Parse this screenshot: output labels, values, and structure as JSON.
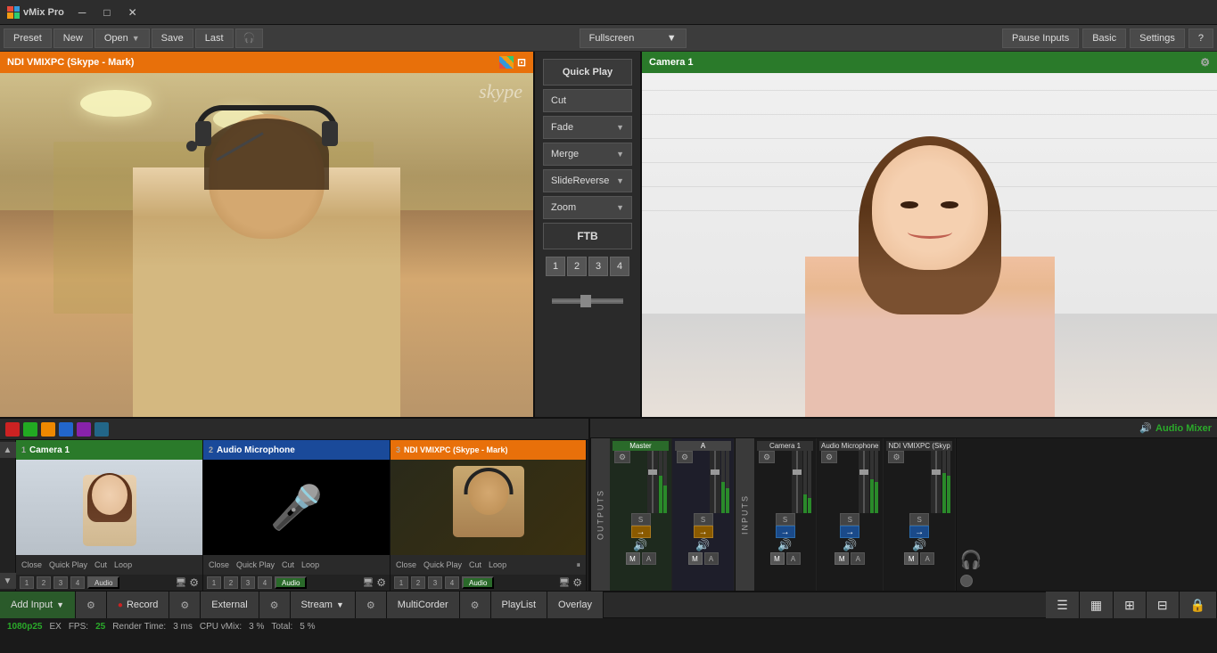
{
  "titlebar": {
    "title": "vMix Pro",
    "min_label": "─",
    "max_label": "□",
    "close_label": "✕"
  },
  "menubar": {
    "preset_label": "Preset",
    "new_label": "New",
    "open_label": "Open",
    "save_label": "Save",
    "last_label": "Last",
    "fullscreen_label": "Fullscreen",
    "pause_inputs_label": "Pause Inputs",
    "basic_label": "Basic",
    "settings_label": "Settings",
    "help_label": "?"
  },
  "preview": {
    "header": "NDI VMIXPC (Skype - Mark)",
    "watermark": "skype"
  },
  "output": {
    "header": "Camera 1"
  },
  "transitions": {
    "quick_play": "Quick Play",
    "cut": "Cut",
    "fade": "Fade",
    "merge": "Merge",
    "slide_reverse": "SlideReverse",
    "zoom": "Zoom",
    "ftb": "FTB",
    "numbers": [
      "1",
      "2",
      "3",
      "4"
    ]
  },
  "inputs": {
    "colors": [
      "red",
      "green",
      "orange",
      "blue",
      "purple",
      "teal"
    ],
    "cards": [
      {
        "num": "1",
        "label": "Camera 1",
        "type": "camera",
        "header_class": "green",
        "controls": [
          "Close",
          "Quick Play",
          "Cut",
          "Loop"
        ],
        "num_buttons": [
          "1",
          "2",
          "3",
          "4"
        ],
        "audio_active": false
      },
      {
        "num": "2",
        "label": "Audio Microphone",
        "type": "audio",
        "header_class": "blue",
        "controls": [
          "Close",
          "Quick Play",
          "Cut",
          "Loop"
        ],
        "num_buttons": [
          "1",
          "2",
          "3",
          "4"
        ],
        "audio_active": true
      },
      {
        "num": "3",
        "label": "NDI VMIXPC (Skype - Mark)",
        "type": "skype",
        "header_class": "orange",
        "controls": [
          "Close",
          "Quick Play",
          "Cut",
          "Loop"
        ],
        "num_buttons": [
          "1",
          "2",
          "3",
          "4"
        ],
        "audio_active": true
      }
    ]
  },
  "audio_mixer": {
    "title": "Audio Mixer",
    "channels": [
      {
        "label": "Master",
        "type": "master"
      },
      {
        "label": "A",
        "type": "a"
      },
      {
        "label": "Camera 1",
        "type": "input"
      },
      {
        "label": "Audio Microphone",
        "type": "input"
      },
      {
        "label": "NDI VMIXPC (Skyp",
        "type": "input"
      }
    ]
  },
  "bottom_toolbar": {
    "add_input": "Add Input",
    "record": "Record",
    "external": "External",
    "stream": "Stream",
    "multicorder": "MultiCorder",
    "playlist": "PlayList",
    "overlay": "Overlay"
  },
  "statusbar": {
    "resolution": "1080p25",
    "ex_label": "EX",
    "fps_label": "FPS:",
    "fps_value": "25",
    "render_label": "Render Time:",
    "render_value": "3 ms",
    "cpu_label": "CPU vMix:",
    "cpu_value": "3 %",
    "total_label": "Total:",
    "total_value": "5 %"
  }
}
